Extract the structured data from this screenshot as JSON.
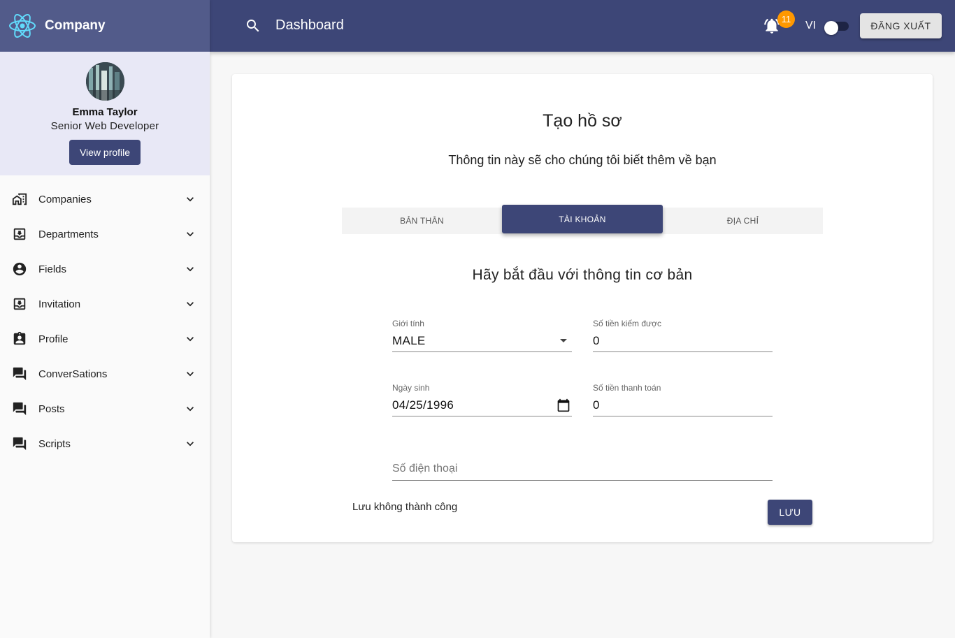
{
  "brand": {
    "name": "Company",
    "logo_icon": "react-atom-icon",
    "color": "#61dafb"
  },
  "user": {
    "name": "Emma Taylor",
    "role": "Senior Web Developer",
    "view_profile_label": "View profile"
  },
  "sidebar": {
    "items": [
      {
        "label": "Companies",
        "icon": "company-buildings-icon"
      },
      {
        "label": "Departments",
        "icon": "inbox-tray-icon"
      },
      {
        "label": "Fields",
        "icon": "account-circle-icon"
      },
      {
        "label": "Invitation",
        "icon": "inbox-tray-icon"
      },
      {
        "label": "Profile",
        "icon": "assignment-ind-icon"
      },
      {
        "label": "ConverSations",
        "icon": "forum-icon"
      },
      {
        "label": "Posts",
        "icon": "forum-icon"
      },
      {
        "label": "Scripts",
        "icon": "forum-icon"
      }
    ]
  },
  "topbar": {
    "title": "Dashboard",
    "notification_count": "11",
    "language": "VI",
    "logout_label": "ĐĂNG XUẤT"
  },
  "form": {
    "title": "Tạo hồ sơ",
    "subtitle": "Thông tin này sẽ cho chúng tôi biết thêm về bạn",
    "tabs": [
      "BẢN THÂN",
      "TÀI KHOẢN",
      "ĐỊA CHỈ"
    ],
    "active_tab": "TÀI KHOẢN",
    "section_title": "Hãy bắt đầu với thông tin cơ bản",
    "gender": {
      "label": "Giới tính",
      "value": "MALE"
    },
    "earned": {
      "label": "Số tiền kiếm được",
      "value": "0"
    },
    "birthdate": {
      "label": "Ngày sinh",
      "value": "04/25/1996"
    },
    "paid": {
      "label": "Số tiền thanh toán",
      "value": "0"
    },
    "phone": {
      "placeholder": "Số điện thoại",
      "value": ""
    },
    "status_text": "Lưu không thành công",
    "save_label": "LƯU"
  },
  "colors": {
    "primary": "#3d4677",
    "brand_bar": "#525b8a",
    "badge": "#ff9800",
    "user_card_bg": "#e8e8f6"
  }
}
